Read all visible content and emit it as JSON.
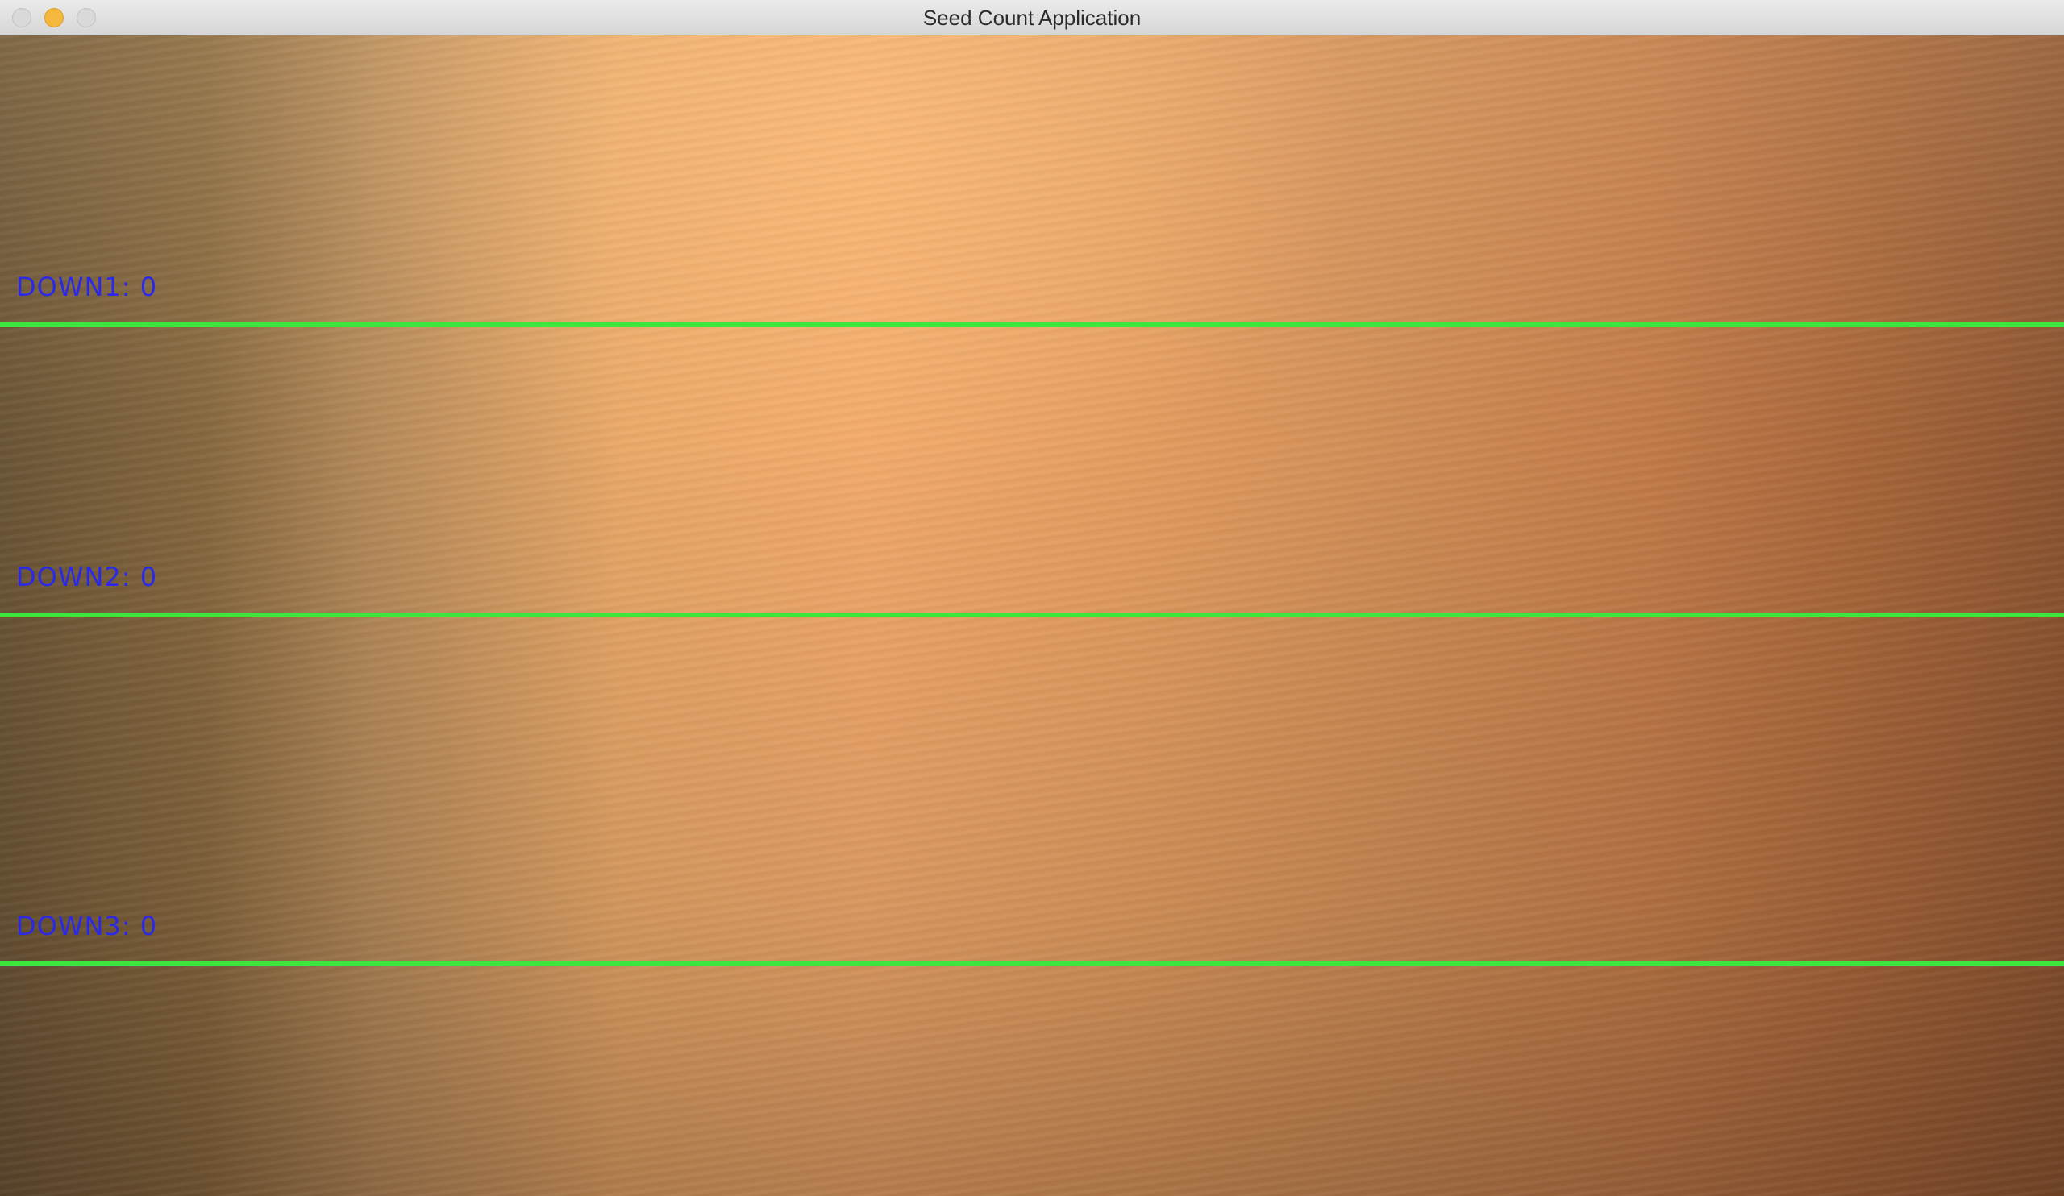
{
  "window": {
    "title": "Seed Count Application"
  },
  "counters": [
    {
      "label": "DOWN1: 0"
    },
    {
      "label": "DOWN2: 0"
    },
    {
      "label": "DOWN3: 0"
    }
  ],
  "colors": {
    "line": "#3ce63c",
    "label": "#2a2ae6"
  }
}
